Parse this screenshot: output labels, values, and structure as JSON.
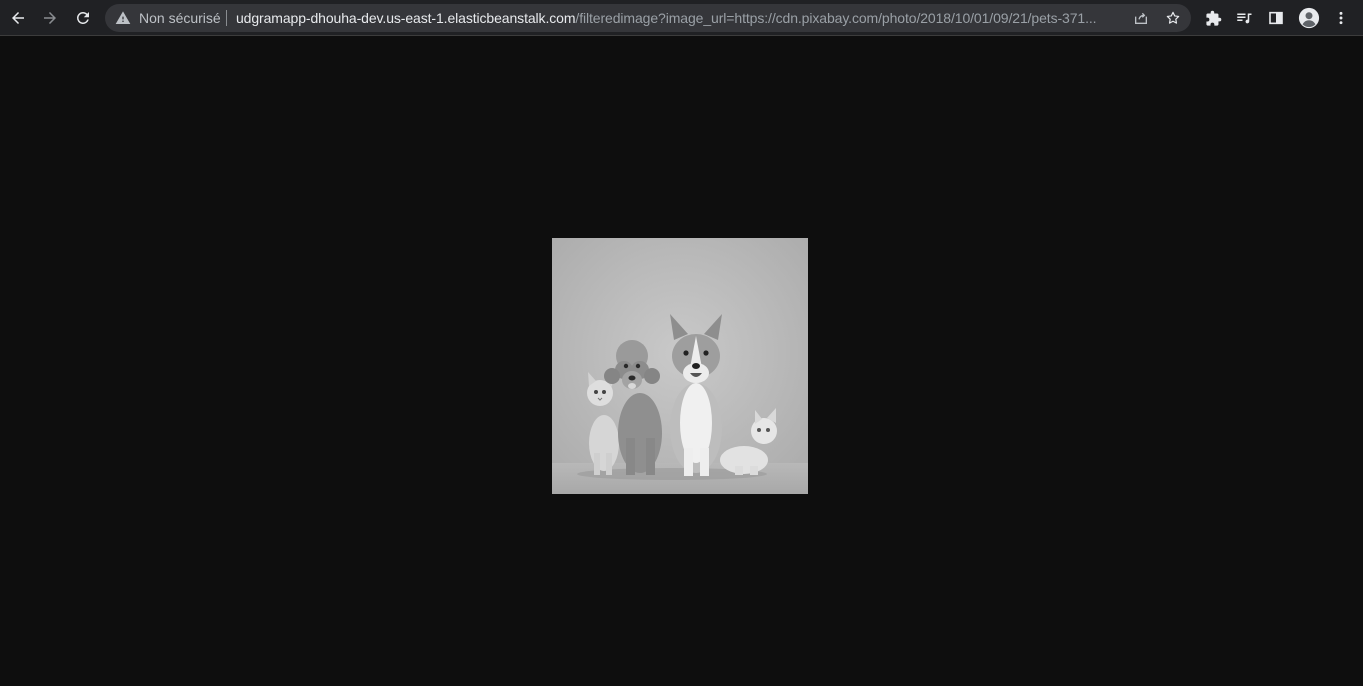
{
  "browser": {
    "security_label": "Non sécurisé",
    "url_host": "udgramapp-dhouha-dev.us-east-1.elasticbeanstalk.com",
    "url_path": "/filteredimage?image_url=https://cdn.pixabay.com/photo/2018/10/01/09/21/pets-371...",
    "icons": [
      "back-arrow-icon",
      "forward-arrow-icon",
      "reload-icon",
      "warning-icon",
      "share-icon",
      "star-icon",
      "extensions-puzzle-icon",
      "media-queue-icon",
      "side-panel-icon",
      "profile-avatar-icon",
      "more-menu-icon"
    ],
    "colors": {
      "toolbar_bg": "#202124",
      "omnibox_bg": "#35363a",
      "page_bg": "#0e0e0e"
    }
  },
  "page": {
    "image_description_semantic": "grayscale-pets-photo"
  }
}
